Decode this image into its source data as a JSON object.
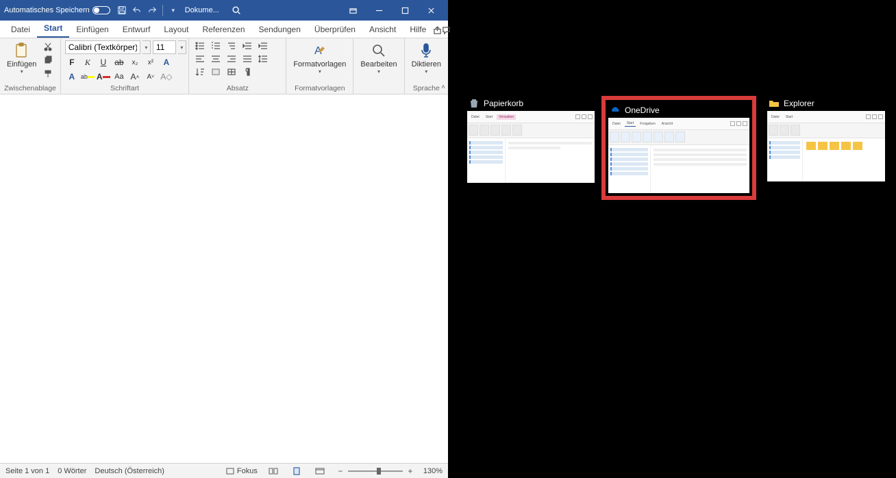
{
  "titlebar": {
    "autosave_label": "Automatisches Speichern",
    "doc_title": "Dokume..."
  },
  "tabs": {
    "datei": "Datei",
    "start": "Start",
    "einfuegen": "Einfügen",
    "entwurf": "Entwurf",
    "layout": "Layout",
    "referenzen": "Referenzen",
    "sendungen": "Sendungen",
    "ueberpruefen": "Überprüfen",
    "ansicht": "Ansicht",
    "hilfe": "Hilfe"
  },
  "ribbon": {
    "clipboard": {
      "paste": "Einfügen",
      "group": "Zwischenablage"
    },
    "font": {
      "name": "Calibri (Textkörper)",
      "size": "11",
      "group": "Schriftart"
    },
    "paragraph": {
      "group": "Absatz"
    },
    "styles": {
      "label": "Formatvorlagen",
      "group": "Formatvorlagen"
    },
    "editing": {
      "label": "Bearbeiten"
    },
    "dictate": {
      "label": "Diktieren",
      "group": "Sprache"
    }
  },
  "status": {
    "page": "Seite 1 von 1",
    "words": "0 Wörter",
    "lang": "Deutsch (Österreich)",
    "focus": "Fokus",
    "zoom": "130%"
  },
  "task_switcher": {
    "t1": "Papierkorb",
    "t2": "OneDrive",
    "t3": "Explorer"
  }
}
